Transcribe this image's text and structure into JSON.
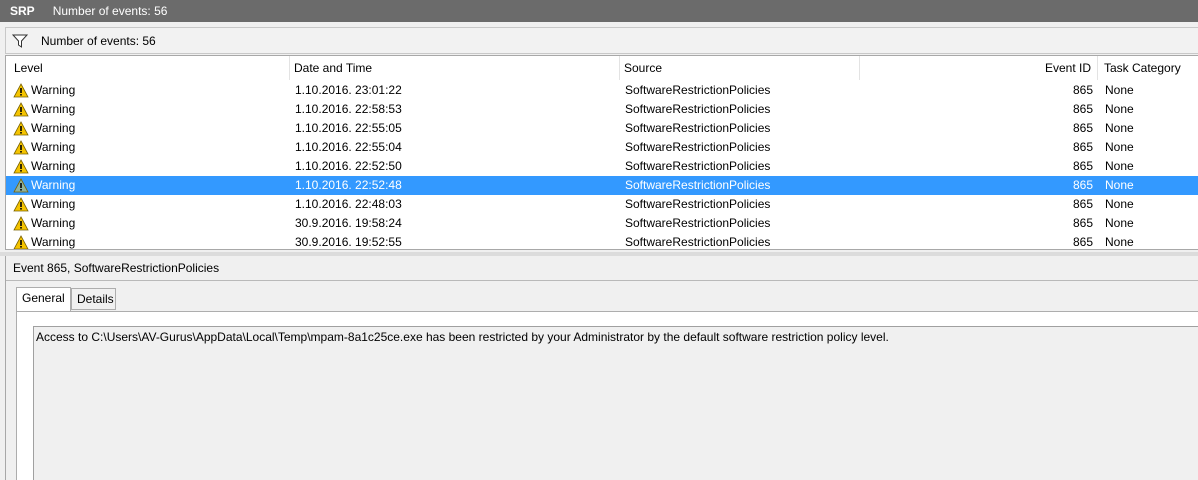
{
  "titlebar": {
    "app_name": "SRP",
    "event_count": "Number of events: 56"
  },
  "filterbar": {
    "icon": "filter-icon",
    "event_count": "Number of events: 56"
  },
  "columns": {
    "level": "Level",
    "date": "Date and Time",
    "source": "Source",
    "event_id": "Event ID",
    "task": "Task Category"
  },
  "rows": [
    {
      "level": "Warning",
      "date": "1.10.2016. 23:01:22",
      "source": "SoftwareRestrictionPolicies",
      "event_id": "865",
      "task": "None"
    },
    {
      "level": "Warning",
      "date": "1.10.2016. 22:58:53",
      "source": "SoftwareRestrictionPolicies",
      "event_id": "865",
      "task": "None"
    },
    {
      "level": "Warning",
      "date": "1.10.2016. 22:55:05",
      "source": "SoftwareRestrictionPolicies",
      "event_id": "865",
      "task": "None"
    },
    {
      "level": "Warning",
      "date": "1.10.2016. 22:55:04",
      "source": "SoftwareRestrictionPolicies",
      "event_id": "865",
      "task": "None"
    },
    {
      "level": "Warning",
      "date": "1.10.2016. 22:52:50",
      "source": "SoftwareRestrictionPolicies",
      "event_id": "865",
      "task": "None"
    },
    {
      "level": "Warning",
      "date": "1.10.2016. 22:52:48",
      "source": "SoftwareRestrictionPolicies",
      "event_id": "865",
      "task": "None",
      "selected": true
    },
    {
      "level": "Warning",
      "date": "1.10.2016. 22:48:03",
      "source": "SoftwareRestrictionPolicies",
      "event_id": "865",
      "task": "None"
    },
    {
      "level": "Warning",
      "date": "30.9.2016. 19:58:24",
      "source": "SoftwareRestrictionPolicies",
      "event_id": "865",
      "task": "None"
    },
    {
      "level": "Warning",
      "date": "30.9.2016. 19:52:55",
      "source": "SoftwareRestrictionPolicies",
      "event_id": "865",
      "task": "None"
    }
  ],
  "details": {
    "title": "Event 865, SoftwareRestrictionPolicies",
    "tabs": [
      "General",
      "Details"
    ],
    "active_tab": "General",
    "message": "Access to C:\\Users\\AV-Gurus\\AppData\\Local\\Temp\\mpam-8a1c25ce.exe has been restricted by your Administrator by the default software restriction policy level."
  },
  "colors": {
    "titlebar_bg": "#6b6b6b",
    "selection_bg": "#3399ff",
    "warning_icon": "#f5c400"
  }
}
